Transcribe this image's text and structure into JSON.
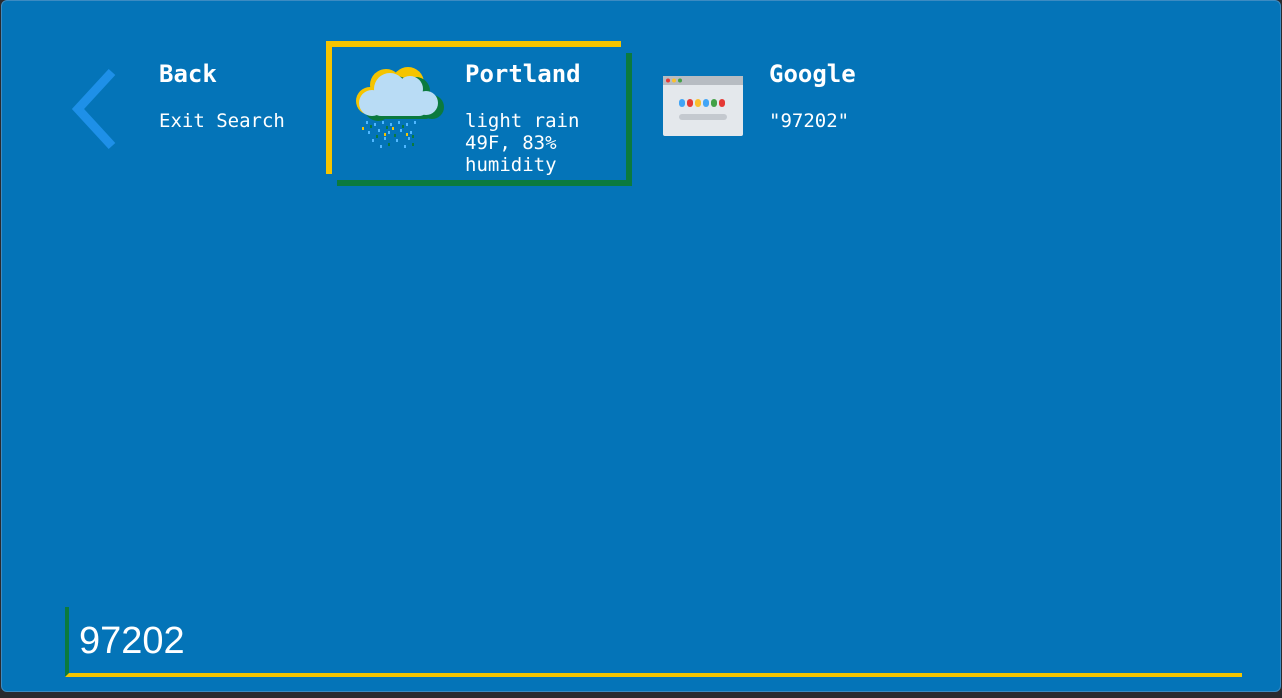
{
  "results": {
    "back": {
      "title": "Back",
      "subtitle": "Exit Search",
      "icon": "chevron-left-icon"
    },
    "weather": {
      "title": "Portland",
      "subtitle": "light rain\n49F, 83%\nhumidity",
      "icon": "rain-cloud-icon",
      "selected": true
    },
    "google": {
      "title": "Google",
      "subtitle": "\"97202\"",
      "icon": "browser-window-icon"
    }
  },
  "search": {
    "value": "97202"
  },
  "colors": {
    "background": "#0474b8",
    "selection_primary": "#f5c400",
    "selection_secondary": "#0b7a3e",
    "chevron": "#1e90e8"
  }
}
